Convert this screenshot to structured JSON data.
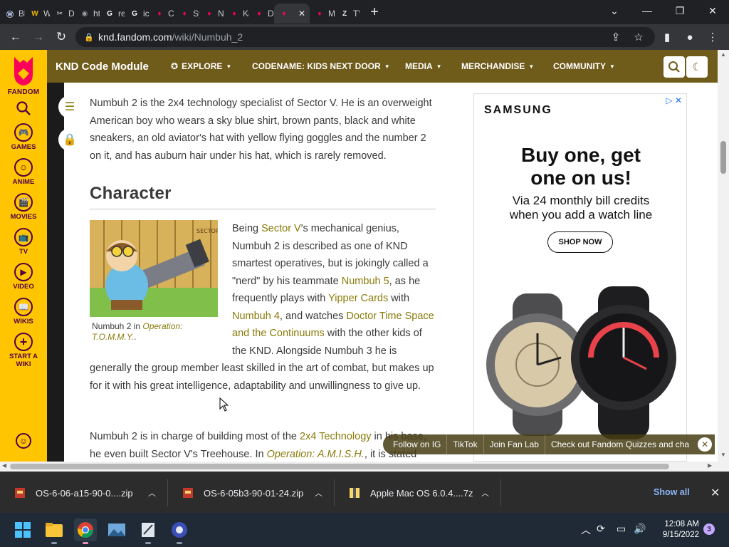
{
  "browser": {
    "tabs": [
      {
        "label": "Bla",
        "fav_text": "Ⓦ",
        "fav_color": "#c9d6ff"
      },
      {
        "label": "Wi",
        "fav_text": "W",
        "fav_color": "#f2b600"
      },
      {
        "label": "Dc",
        "fav_text": "✂",
        "fav_color": "#e8eaed"
      },
      {
        "label": "htt",
        "fav_text": "◉",
        "fav_color": "#9aa0a6"
      },
      {
        "label": "rec",
        "fav_text": "G",
        "fav_color": "#ffffff"
      },
      {
        "label": "icn",
        "fav_text": "G",
        "fav_color": "#ffffff"
      },
      {
        "label": "Ca",
        "fav_text": "♦",
        "fav_color": "#fa005a"
      },
      {
        "label": "Sy",
        "fav_text": "♦",
        "fav_color": "#fa005a"
      },
      {
        "label": "Nu",
        "fav_text": "♦",
        "fav_color": "#fa005a"
      },
      {
        "label": "Ka",
        "fav_text": "♦",
        "fav_color": "#fa005a"
      },
      {
        "label": "Dr",
        "fav_text": "♦",
        "fav_color": "#fa005a"
      },
      {
        "label": "",
        "fav_text": "♦",
        "fav_color": "#fa005a",
        "active": true
      },
      {
        "label": "Mi",
        "fav_text": "♦",
        "fav_color": "#fa005a"
      },
      {
        "label": "TV",
        "fav_text": "Z",
        "fav_color": "#e8eaed"
      }
    ],
    "url_host": "knd.fandom.com",
    "url_path": "/wiki/Numbuh_2"
  },
  "fandom_rail": {
    "logo_label": "FANDOM",
    "items": [
      {
        "label": "GAMES",
        "icon": "🎮"
      },
      {
        "label": "ANIME",
        "icon": "☺"
      },
      {
        "label": "MOVIES",
        "icon": "🎬"
      },
      {
        "label": "TV",
        "icon": "📺"
      },
      {
        "label": "VIDEO",
        "icon": "▶"
      },
      {
        "label": "WIKIS",
        "icon": "📖"
      }
    ],
    "start_wiki": "START A WIKI"
  },
  "wiki_header": {
    "name": "KND Code Module",
    "nav": [
      "EXPLORE",
      "CODENAME: KIDS NEXT DOOR",
      "MEDIA",
      "MERCHANDISE",
      "COMMUNITY"
    ]
  },
  "article": {
    "p1": "Numbuh 2 is the 2x4 technology specialist of Sector V. He is an overweight American boy who wears a sky blue shirt, brown pants, black and white sneakers, an old aviator's hat with yellow flying goggles and the number 2 on it, and has auburn hair under his hat, which is rarely removed.",
    "section_title": "Character",
    "caption_prefix": "Numbuh 2 in ",
    "caption_link": "Operation: T.O.M.M.Y.",
    "caption_suffix": ".",
    "p2": {
      "t1": "Being ",
      "l1": "Sector V",
      "t2": "'s mechanical genius, Numbuh 2 is described as one of KND smartest operatives, but is jokingly called a \"nerd\" by his teammate ",
      "l2": "Numbuh 5",
      "t3": ", as he frequently plays with ",
      "l3": "Yipper Cards",
      "t4": " with ",
      "l4": "Numbuh 4",
      "t5": ", and watches ",
      "l5": "Doctor Time Space and the Continuums",
      "t6": " with the other kids of the KND. Alongside Numbuh 3 he is generally the group member least skilled in the art of combat, but makes up for it with his great intelligence, adaptability and unwillingness to give up."
    },
    "p3": {
      "t1": "Numbuh 2 is in charge of building most of the ",
      "l1": "2x4 Technology",
      "t2": " in his base, he even built Sector V's Treehouse. In ",
      "l2": "Operation: A.M.I.S.H.",
      "t3": ", it is stated that"
    }
  },
  "ad": {
    "brand": "SAMSUNG",
    "headline_1": "Buy one, get",
    "headline_2": "one on us!",
    "sub_1": "Via 24 monthly bill credits",
    "sub_2": "when you add a watch line",
    "cta": "SHOP NOW"
  },
  "social_bar": [
    "Follow on IG",
    "TikTok",
    "Join Fan Lab",
    "Check out Fandom Quizzes and cha"
  ],
  "downloads": {
    "items": [
      "OS-6-06-a15-90-0....zip",
      "OS-6-05b3-90-01-24.zip",
      "Apple Mac OS 6.0.4....7z"
    ],
    "show_all": "Show all"
  },
  "taskbar": {
    "time": "12:08 AM",
    "date": "9/15/2022",
    "notifications": "3"
  },
  "colors": {
    "fandom_yellow": "#ffc500",
    "wiki_header": "#6f5b1a",
    "link": "#8a7a09"
  }
}
